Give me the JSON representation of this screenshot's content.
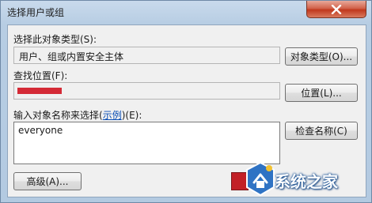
{
  "window": {
    "title": "选择用户或组"
  },
  "object_type": {
    "label": "选择此对象类型(S):",
    "value": "用户、组或内置安全主体",
    "button_label": "对象类型(O)..."
  },
  "location": {
    "label": "查找位置(F):",
    "button_label": "位置(L)..."
  },
  "object_names": {
    "label_prefix": "输入对象名称来选择(",
    "example_link": "示例",
    "label_suffix": ")(E):",
    "value": "everyone",
    "check_names_label": "检查名称(C)"
  },
  "advanced": {
    "label": "高级(A)..."
  },
  "watermark": {
    "text": "系统之家"
  },
  "colors": {
    "close_button": "#c9462c",
    "redaction": "#d42a36",
    "link": "#0a4eb5"
  }
}
